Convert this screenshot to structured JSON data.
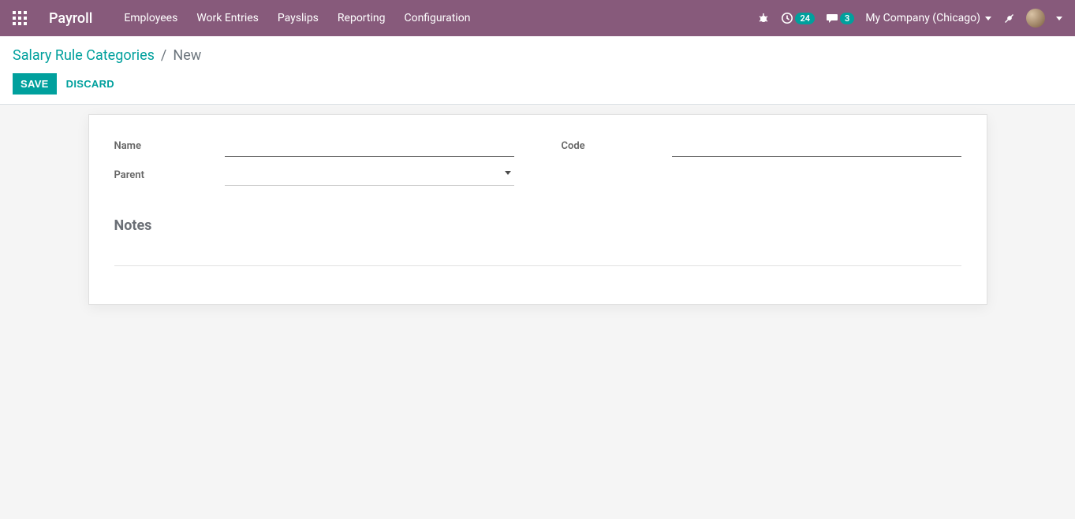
{
  "nav": {
    "app_title": "Payroll",
    "menu": [
      "Employees",
      "Work Entries",
      "Payslips",
      "Reporting",
      "Configuration"
    ],
    "badge_activities": "24",
    "badge_messages": "3",
    "company": "My Company (Chicago)"
  },
  "breadcrumb": {
    "parent": "Salary Rule Categories",
    "separator": "/",
    "current": "New"
  },
  "buttons": {
    "save": "Save",
    "discard": "Discard"
  },
  "form": {
    "labels": {
      "name": "Name",
      "parent": "Parent",
      "code": "Code",
      "notes": "Notes"
    },
    "values": {
      "name": "",
      "parent": "",
      "code": ""
    }
  }
}
